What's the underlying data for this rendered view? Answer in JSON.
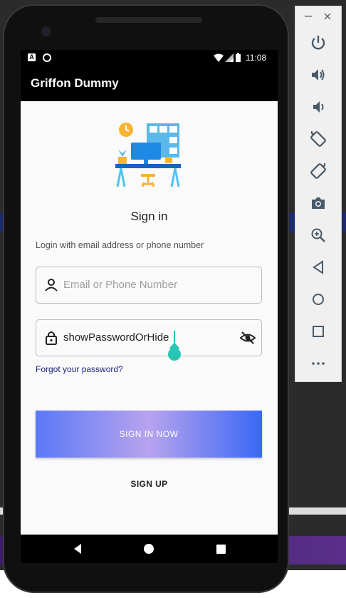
{
  "statusbar": {
    "icon_a": "A",
    "time": "11:08"
  },
  "app": {
    "title": "Griffon Dummy"
  },
  "login": {
    "heading": "Sign in",
    "subtext": "Login with email address or phone number",
    "email_placeholder": "Email or Phone Number",
    "password_value": "showPasswordOrHide",
    "forgot_label": "Forgot your password?",
    "signin_label": "SIGN IN NOW",
    "signup_label": "SIGN UP"
  },
  "colors": {
    "accent": "#26c6b3",
    "button_gradient_start": "#5b79f6",
    "button_gradient_mid": "#b7a3ee",
    "button_gradient_end": "#3a68f5",
    "link": "#1a237e"
  },
  "emulator_toolbar": {
    "window_controls": [
      "minimize-icon",
      "close-icon"
    ],
    "items": [
      "power-icon",
      "volume-up-icon",
      "volume-down-icon",
      "rotate-left-icon",
      "rotate-right-icon",
      "camera-icon",
      "zoom-icon",
      "back-icon",
      "home-icon",
      "overview-icon",
      "more-icon"
    ]
  }
}
